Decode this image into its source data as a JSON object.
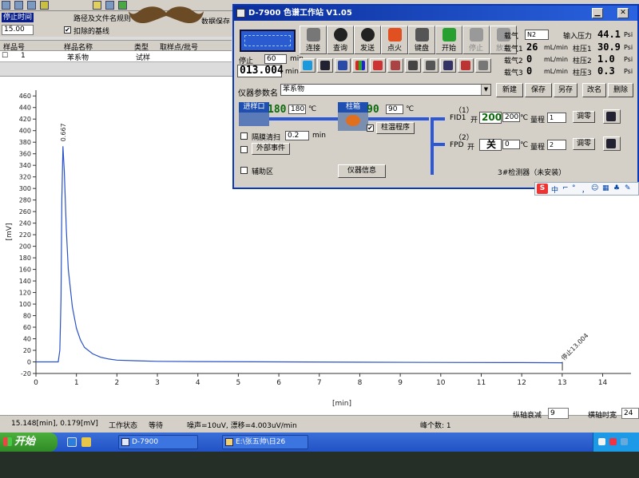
{
  "app": {
    "toolbar_icons": [
      "folder-icon",
      "save-icon",
      "print-icon",
      "copy-icon",
      "lamp-icon",
      "disk-icon",
      "flag-icon"
    ],
    "stop_time_label": "停止时间",
    "stop_time_value": "15.00",
    "path_label": "路径及文件名规则",
    "data_save_label": "数据保存",
    "deduct_baseline_checked": "✔",
    "deduct_baseline_label": "扣除的基线",
    "grid_headers": {
      "sample_no": "样品号",
      "sample_name": "样品名称",
      "type": "类型",
      "pick_point": "取样点/批号"
    },
    "grid_row": {
      "index": "1",
      "sample_name": "苯系物",
      "type": "试样"
    }
  },
  "chart_data": {
    "type": "line",
    "title": "",
    "xlabel": "[min]",
    "ylabel": "[mV]",
    "xlim": [
      0,
      14.7
    ],
    "ylim": [
      -20,
      470
    ],
    "x_ticks": [
      "0",
      "1",
      "2",
      "3",
      "4",
      "5",
      "6",
      "7",
      "8",
      "9",
      "10",
      "11",
      "12",
      "13",
      "14"
    ],
    "y_ticks": [
      "460",
      "440",
      "420",
      "400",
      "380",
      "360",
      "340",
      "320",
      "300",
      "280",
      "260",
      "240",
      "220",
      "200",
      "180",
      "160",
      "140",
      "120",
      "100",
      "80",
      "60",
      "40",
      "20",
      "0",
      "-20"
    ],
    "grid": false,
    "peak_label": "0.667",
    "stop_label": "停止13.004",
    "stop_x": 13.004,
    "series": [
      {
        "x": [
          0,
          0.55,
          0.59,
          0.62,
          0.64,
          0.667,
          0.7,
          0.75,
          0.8,
          0.9,
          1.0,
          1.1,
          1.2,
          1.4,
          1.6,
          1.8,
          2.0,
          2.5,
          3.0,
          4.0,
          6.0,
          8.0,
          10.0,
          12.0,
          13.004
        ],
        "y": [
          0,
          0,
          20,
          110,
          280,
          373,
          330,
          230,
          160,
          95,
          58,
          38,
          25,
          14,
          8,
          5,
          3,
          2,
          1,
          0.5,
          0,
          -0.5,
          -1,
          -1.2,
          -1.5
        ]
      }
    ],
    "colors": {
      "line": "#2a52c8",
      "axis": "#333333"
    }
  },
  "status": {
    "cursor_readout": "15.148[min], 0.179[mV]",
    "work_state_label": "工作状态",
    "work_state_value": "等待",
    "noise": "噪声=10uV, 漂移=4.003uV/min",
    "peak_count": "峰个数: 1",
    "y_atten_label": "纵轴衰减",
    "y_atten_value": "9",
    "x_width_label": "横轴时宽",
    "x_width_value": "24"
  },
  "taskbar": {
    "start_label": "开始",
    "task1_label": "D-7900",
    "task2_label": "E:\\张五帅\\日26"
  },
  "dialog": {
    "title": "D-7900  色谱工作站  V1.05",
    "stop_label": "停止",
    "stop_input": "60",
    "min_label": "min",
    "elapsed_time": "013.004",
    "buttons": {
      "connect": "连接",
      "query": "查询",
      "send": "发送",
      "ignite": "点火",
      "keyboard": "键盘",
      "start": "开始",
      "stop": "停止",
      "discard": "放弃"
    },
    "gas": {
      "carrier_gas_label": "载气",
      "carrier_gas_type": "N2",
      "input_pressure_label": "输入压力",
      "input_pressure_value": "44.1",
      "pressure_unit": "Psi",
      "rows": [
        {
          "label": "载气1",
          "flow": "26",
          "flow_unit": "mL/min",
          "col_label": "柱压1",
          "col_value": "30.9"
        },
        {
          "label": "载气2",
          "flow": "0",
          "flow_unit": "mL/min",
          "col_label": "柱压2",
          "col_value": "1.0"
        },
        {
          "label": "载气3",
          "flow": "0",
          "flow_unit": "mL/min",
          "col_label": "柱压3",
          "col_value": "0.3"
        }
      ]
    },
    "param_label": "仪器参数名",
    "param_value": "苯系物",
    "actions": {
      "new": "新建",
      "save": "保存",
      "save_as": "另存",
      "rename": "改名",
      "delete": "删除"
    },
    "injector": {
      "label": "进样口",
      "temp": "180",
      "setpoint": "180",
      "unit": "℃"
    },
    "column": {
      "label": "柱箱",
      "temp": "90",
      "setpoint": "90",
      "unit": "℃",
      "program_checked": "✔",
      "program_label": "柱温程序"
    },
    "septum_purge_label": "隔膜清扫",
    "septum_purge_value": "0.2",
    "external_event_label": "外部事件",
    "aux_zone_label": "辅助区",
    "instrument_info_label": "仪器信息",
    "detector1": {
      "index": "（1）",
      "name": "FID1",
      "state": "开",
      "temp": "200",
      "setpoint": "200",
      "unit": "℃",
      "range_label": "量程",
      "range_value": "1",
      "zero_label": "调零"
    },
    "detector2": {
      "index": "（2）",
      "name": "FPD",
      "state_label": "开",
      "state": "关",
      "setpoint": "0",
      "unit": "℃",
      "range_label": "量程",
      "range_value": "2",
      "zero_label": "调零"
    },
    "detector3_text": "3#检测器（未安装）"
  },
  "ime": {
    "logo": "S",
    "mode": "中",
    "punct": "⌐",
    "items": [
      "°",
      "，",
      "☺",
      "▦",
      "♣",
      "✎"
    ]
  }
}
